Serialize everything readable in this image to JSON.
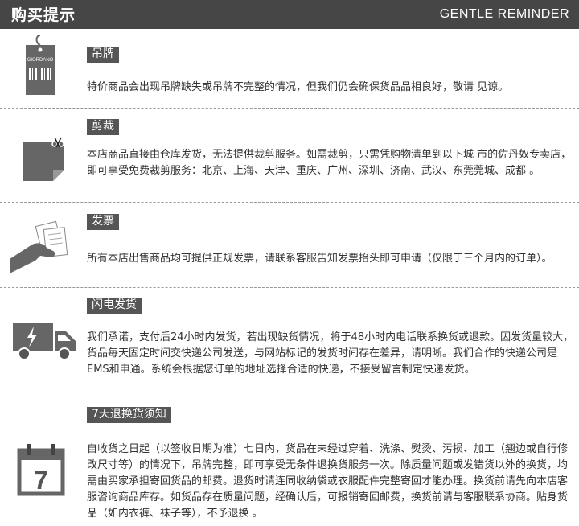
{
  "header": {
    "title": "购买提示",
    "subtitle": "GENTLE REMINDER"
  },
  "sections": [
    {
      "label": "吊牌",
      "icon": "hang-tag-icon",
      "tag_brand": "GIORDANO",
      "text": "特价商品会出现吊牌缺失或吊牌不完整的情况，但我们仍会确保货品品相良好，敬请 见谅。"
    },
    {
      "label": "剪裁",
      "icon": "scissors-fabric-icon",
      "text": "本店商品直接由仓库发货，无法提供裁剪服务。如需裁剪，只需凭购物清单到以下城 市的佐丹奴专卖店，即可享受免费裁剪服务：北京、上海、天津、重庆、广州、深圳、济南、武汉、东莞莞城、成都 。"
    },
    {
      "label": "发票",
      "icon": "hand-receipt-icon",
      "text": "所有本店出售商品均可提供正规发票，请联系客服告知发票抬头即可申请（仅限于三个月内的订单）。"
    },
    {
      "label": "闪电发货",
      "icon": "delivery-truck-icon",
      "text": "我们承诺，支付后24小时内发货，若出现缺货情况，将于48小时内电话联系换货或退款。因发货量较大，货品每天固定时间交快递公司发送，与网站标记的发货时间存在差异，请明晰。我们合作的快递公司是EMS和申通。系统会根据您订单的地址选择合适的快递，不接受留言制定快递发货。"
    },
    {
      "label": "7天退换货须知",
      "icon": "calendar-7-icon",
      "calendar_number": "7",
      "text": "自收货之日起（以签收日期为准）七日内，货品在未经过穿着、洗涤、熨烫、污损、加工（翘边或自行修改尺寸等）的情况下，吊牌完整，即可享受无条件退换货服务一次。除质量问题或发错货以外的换货，均需由买家承担寄回货品的邮费。退货时请连同收纳袋或衣服配件完整寄回才能办理。换货前请先向本店客服咨询商品库存。如货品存在质量问题，经确认后，可报销寄回邮费，换货前请与客服联系协商。贴身货品（如内衣裤、袜子等），不予退换 。"
    }
  ]
}
